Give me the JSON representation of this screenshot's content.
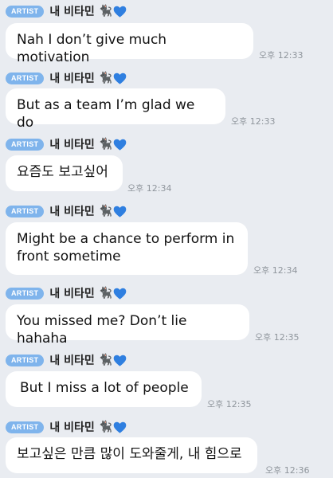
{
  "sender": {
    "badge": "ARTIST",
    "name": "내 비타민",
    "cat_glyph": "🐈‍⬛",
    "heart_color": "#2f7fe0"
  },
  "messages": [
    {
      "text": "Nah I don’t give much motivation",
      "time": "오후 12:33"
    },
    {
      "text": "But as a team I’m glad we do",
      "time": "오후 12:33"
    },
    {
      "text": "요즘도 보고싶어",
      "time": "오후 12:34"
    },
    {
      "text": "Might be a chance to perform in\nfront sometime",
      "time": "오후 12:34"
    },
    {
      "text": "You missed me? Don’t lie hahaha",
      "time": "오후 12:35"
    },
    {
      "text": "But I miss a lot of people",
      "time": "오후 12:35"
    },
    {
      "text": "보고싶은 만큼 많이 도와줄게, 내 힘으로",
      "time": "오후 12:36"
    }
  ]
}
